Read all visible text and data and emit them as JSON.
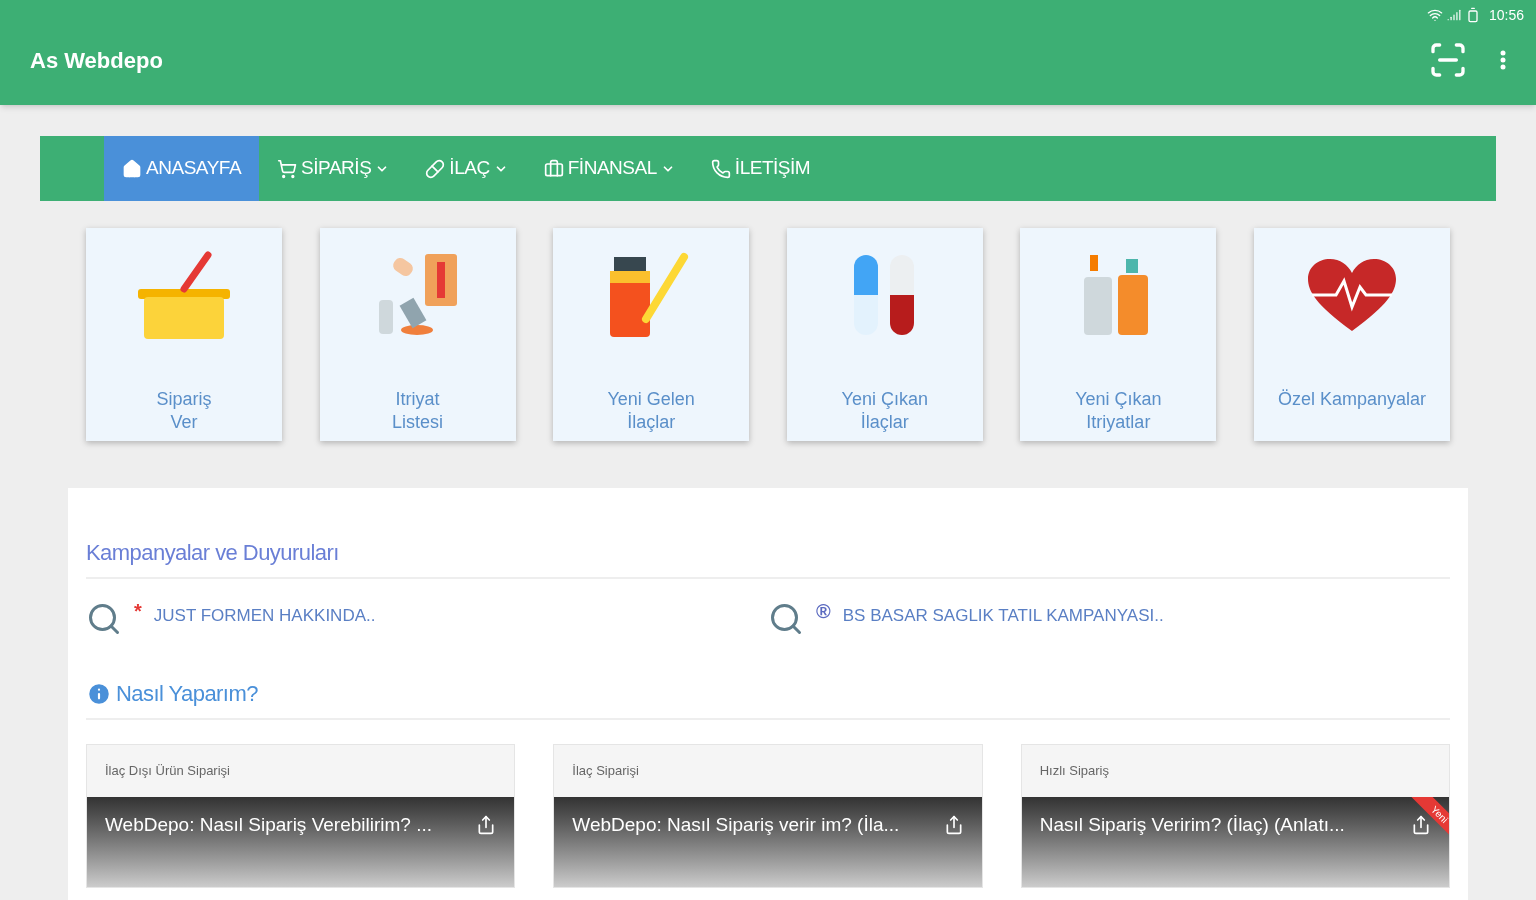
{
  "status_bar": {
    "time": "10:56"
  },
  "app_bar": {
    "title": "As Webdepo"
  },
  "nav": [
    {
      "label": "ANASAYFA",
      "kind": "home",
      "selected": true,
      "dropdown": false
    },
    {
      "label": "SİPARİŞ",
      "kind": "cart",
      "selected": false,
      "dropdown": true
    },
    {
      "label": "İLAÇ",
      "kind": "pill",
      "selected": false,
      "dropdown": true
    },
    {
      "label": "FİNANSAL",
      "kind": "briefcase",
      "selected": false,
      "dropdown": true
    },
    {
      "label": "İLETİŞİM",
      "kind": "phone",
      "selected": false,
      "dropdown": false
    }
  ],
  "tiles": [
    {
      "kind": "basket",
      "lines": [
        "Sipariş",
        "Ver"
      ]
    },
    {
      "kind": "cosmetics",
      "lines": [
        "Itriyat",
        "Listesi"
      ]
    },
    {
      "kind": "vial",
      "lines": [
        "Yeni Gelen",
        "İlaçlar"
      ]
    },
    {
      "kind": "capsules",
      "lines": [
        "Yeni Çıkan",
        "İlaçlar"
      ]
    },
    {
      "kind": "bottles",
      "lines": [
        "Yeni Çıkan",
        "Itriyatlar"
      ]
    },
    {
      "kind": "heart",
      "lines": [
        "Özel Kampanyalar"
      ]
    }
  ],
  "announcements": {
    "title": "Kampanyalar ve Duyuruları",
    "items": [
      {
        "mark": "*",
        "text": "JUST FORMEN HAKKINDA..",
        "color": "#e53935"
      },
      {
        "mark": "®",
        "text": "BS BASAR SAGLIK TATIL KAMPANYASI..",
        "color": "#5c6bc0"
      }
    ]
  },
  "howto": {
    "title": "Nasıl Yaparım?",
    "videos": [
      {
        "heading": "İlaç Dışı Ürün Siparişi",
        "title": "WebDepo: Nasıl Sipariş Verebilirim? ..."
      },
      {
        "heading": "İlaç Siparişi",
        "title": "WebDepo: Nasıl Sipariş verir im? (İla..."
      },
      {
        "heading": "Hızlı Sipariş",
        "title": "Nasıl Sipariş Veririm? (İlaç) (Anlatı...",
        "ribbon": "Yeni"
      }
    ]
  }
}
